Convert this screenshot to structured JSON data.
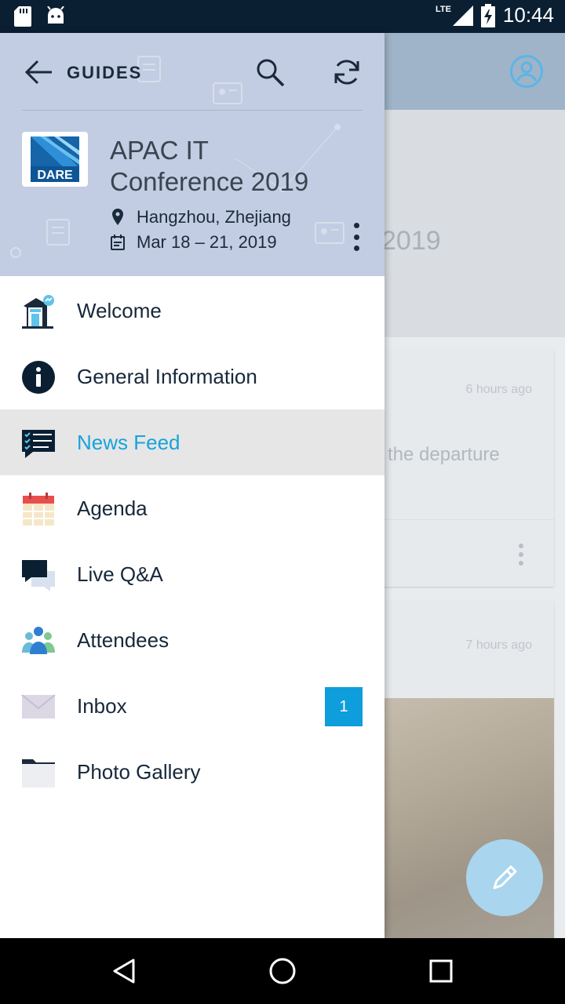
{
  "status_bar": {
    "network": "LTE",
    "time": "10:44"
  },
  "drawer": {
    "header": {
      "back_label": "GUIDES",
      "logo_text": "DARE",
      "event_title": "APAC IT Conference 2019",
      "location": "Hangzhou, Zhejiang",
      "dates": "Mar 18 – 21, 2019"
    },
    "menu": [
      {
        "label": "Welcome",
        "icon": "welcome-house-icon",
        "active": false
      },
      {
        "label": "General Information",
        "icon": "info-icon",
        "active": false
      },
      {
        "label": "News Feed",
        "icon": "news-feed-icon",
        "active": true
      },
      {
        "label": "Agenda",
        "icon": "calendar-icon",
        "active": false
      },
      {
        "label": "Live Q&A",
        "icon": "chat-bubbles-icon",
        "active": false
      },
      {
        "label": "Attendees",
        "icon": "people-icon",
        "active": false
      },
      {
        "label": "Inbox",
        "icon": "envelope-icon",
        "active": false,
        "badge": "1"
      },
      {
        "label": "Photo Gallery",
        "icon": "folder-icon",
        "active": false
      }
    ]
  },
  "background": {
    "hero_year": "2019",
    "card1": {
      "time": "6 hours ago",
      "text": "the departure"
    },
    "card2": {
      "time": "7 hours ago"
    }
  },
  "colors": {
    "accent": "#17a3dc",
    "header_bg": "#c2cde3",
    "badge_bg": "#0e9edb",
    "status_bar_bg": "#0b1f33"
  }
}
